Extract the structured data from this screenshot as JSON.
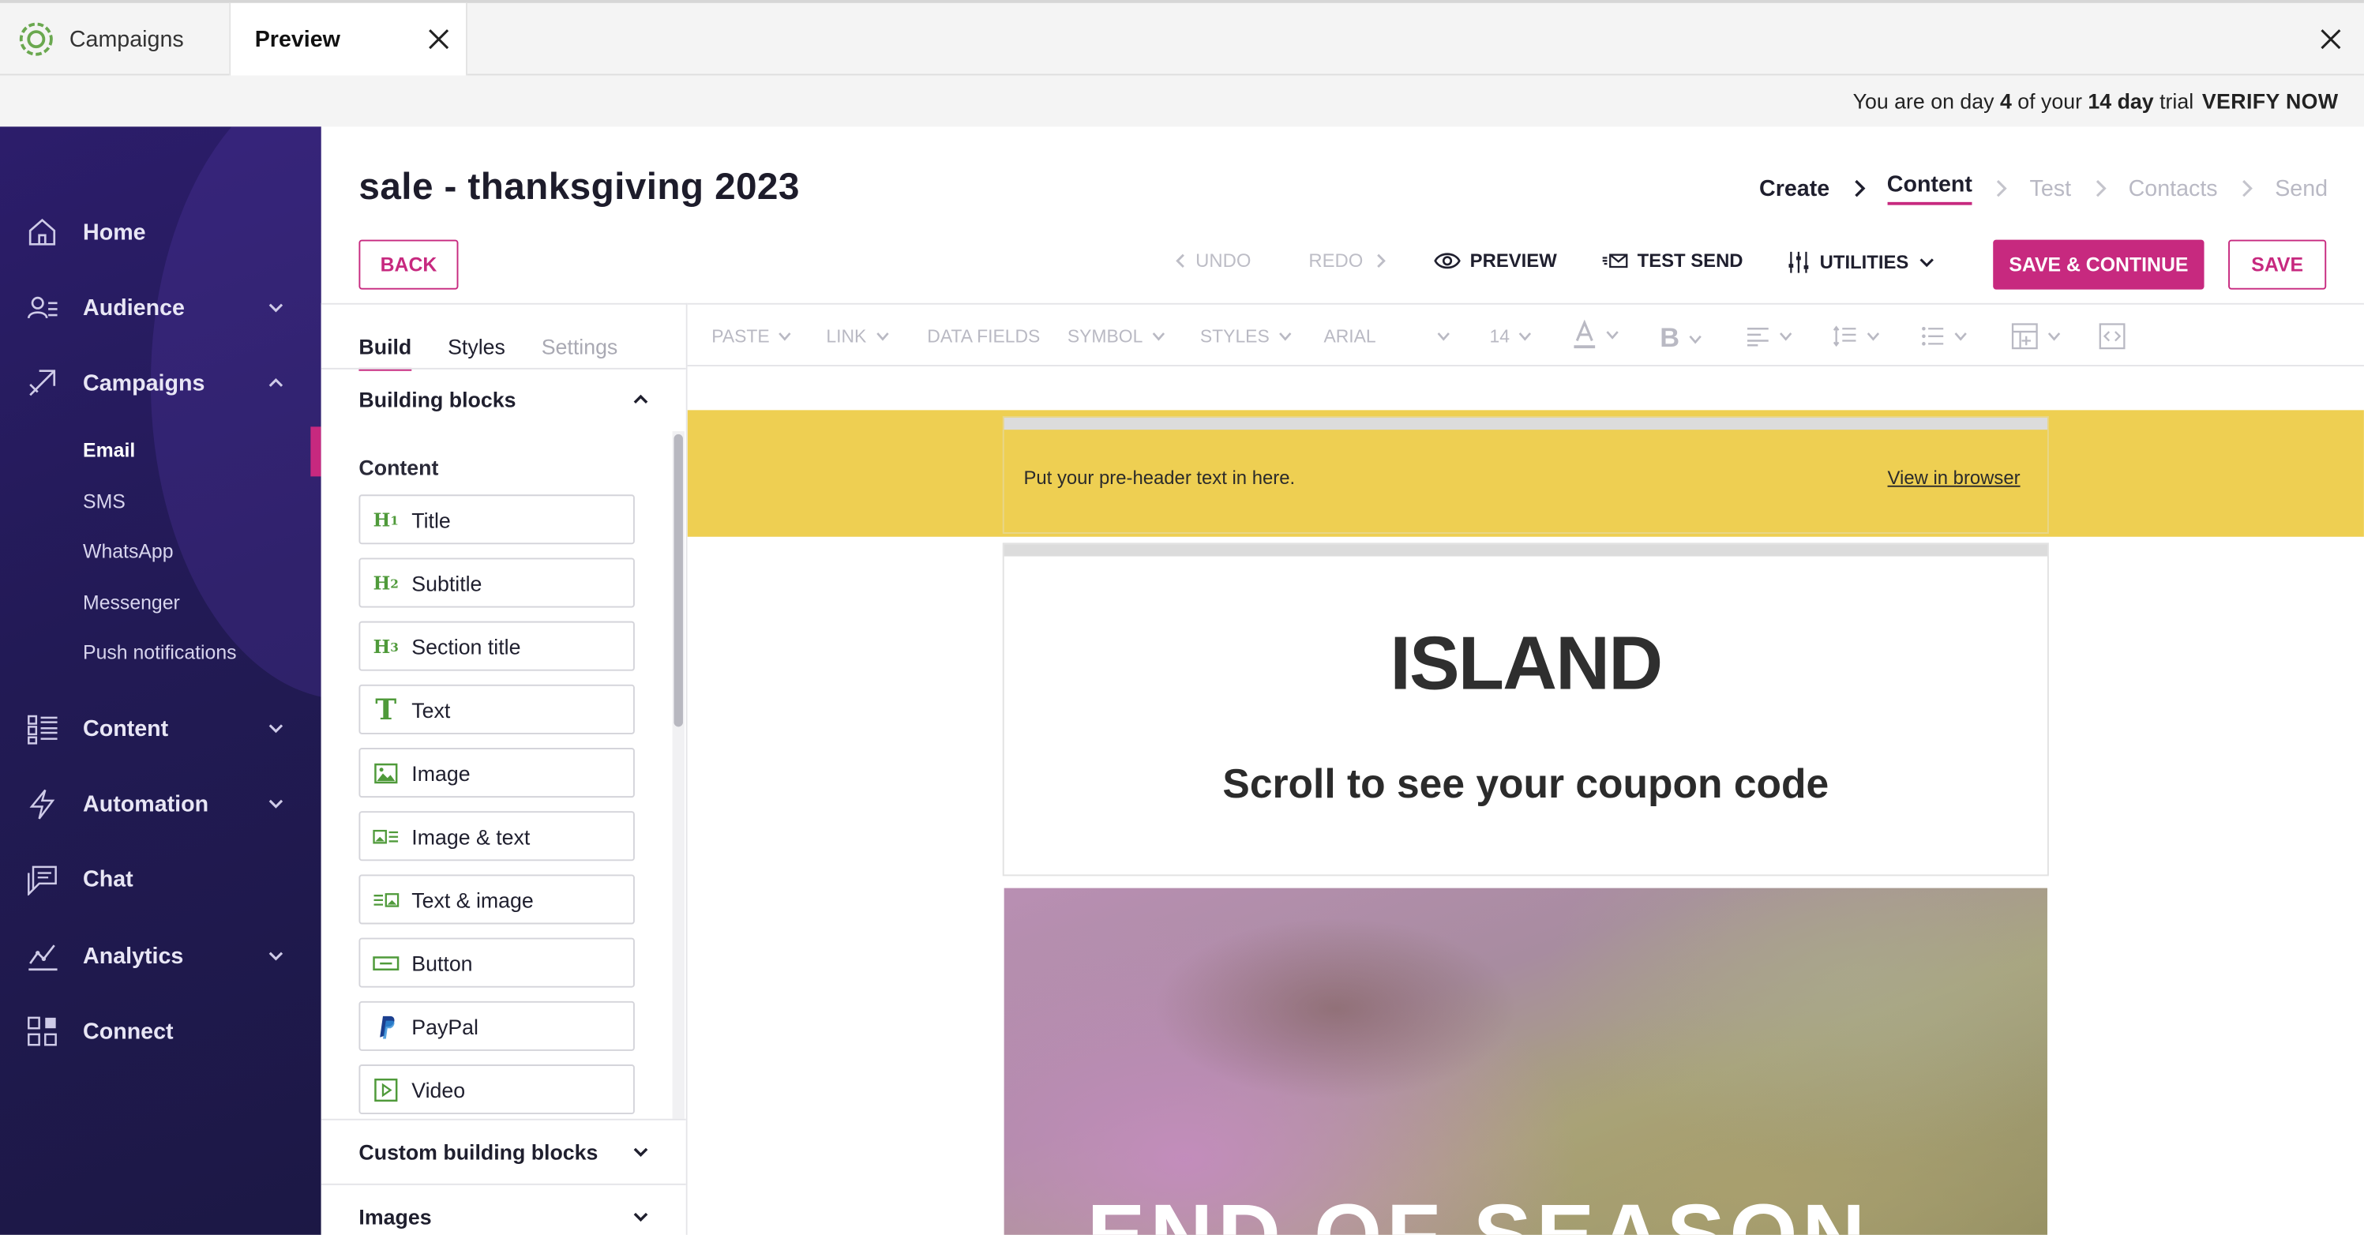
{
  "browser": {
    "tabs": [
      {
        "label": "Campaigns",
        "active": false
      },
      {
        "label": "Preview",
        "active": true
      }
    ]
  },
  "trial": {
    "msg_prefix": "You are on day",
    "day": "4",
    "msg_mid": "of your",
    "length": "14 day",
    "msg_suffix": "trial",
    "verify": "VERIFY NOW"
  },
  "sidebar": {
    "items": [
      {
        "label": "Home",
        "icon": "home-icon"
      },
      {
        "label": "Audience",
        "icon": "audience-icon"
      },
      {
        "label": "Campaigns",
        "icon": "campaigns-icon"
      },
      {
        "label": "Content",
        "icon": "content-icon"
      },
      {
        "label": "Automation",
        "icon": "automation-icon"
      },
      {
        "label": "Chat",
        "icon": "chat-icon"
      },
      {
        "label": "Analytics",
        "icon": "analytics-icon"
      },
      {
        "label": "Connect",
        "icon": "connect-icon"
      }
    ],
    "campaign_sub": [
      "Email",
      "SMS",
      "WhatsApp",
      "Messenger",
      "Push notifications"
    ],
    "active_sub": "Email"
  },
  "header": {
    "title": "sale - thanksgiving 2023",
    "steps": [
      "Create",
      "Content",
      "Test",
      "Contacts",
      "Send"
    ],
    "current_step": "Content"
  },
  "actions": {
    "back": "BACK",
    "undo": "UNDO",
    "redo": "REDO",
    "preview": "PREVIEW",
    "test_send": "TEST SEND",
    "utilities": "UTILITIES",
    "save_continue": "SAVE & CONTINUE",
    "save": "SAVE"
  },
  "panel": {
    "tabs": [
      "Build",
      "Styles",
      "Settings"
    ],
    "building_blocks": "Building blocks",
    "content_label": "Content",
    "blocks": [
      {
        "label": "Title",
        "icon": "h1-icon"
      },
      {
        "label": "Subtitle",
        "icon": "h2-icon"
      },
      {
        "label": "Section title",
        "icon": "h3-icon"
      },
      {
        "label": "Text",
        "icon": "text-icon"
      },
      {
        "label": "Image",
        "icon": "image-icon"
      },
      {
        "label": "Image & text",
        "icon": "image-text-icon"
      },
      {
        "label": "Text & image",
        "icon": "text-image-icon"
      },
      {
        "label": "Button",
        "icon": "button-icon"
      },
      {
        "label": "PayPal",
        "icon": "paypal-icon"
      },
      {
        "label": "Video",
        "icon": "video-icon"
      }
    ],
    "custom_blocks": "Custom building blocks",
    "images": "Images"
  },
  "editor_toolbar": {
    "paste": "PASTE",
    "link": "LINK",
    "data_fields": "DATA FIELDS",
    "symbol": "SYMBOL",
    "styles": "STYLES",
    "font": "ARIAL",
    "size": "14"
  },
  "email": {
    "preheader": "Put your pre-header text in here.",
    "view_in_browser": "View in browser",
    "brand": "ISLAND",
    "headline": "Scroll to see your coupon code",
    "hero_text": "END OF SEASON"
  },
  "colors": {
    "accent": "#c7297f",
    "sidebar": "#221a55",
    "preheader_band": "#eecf52"
  }
}
